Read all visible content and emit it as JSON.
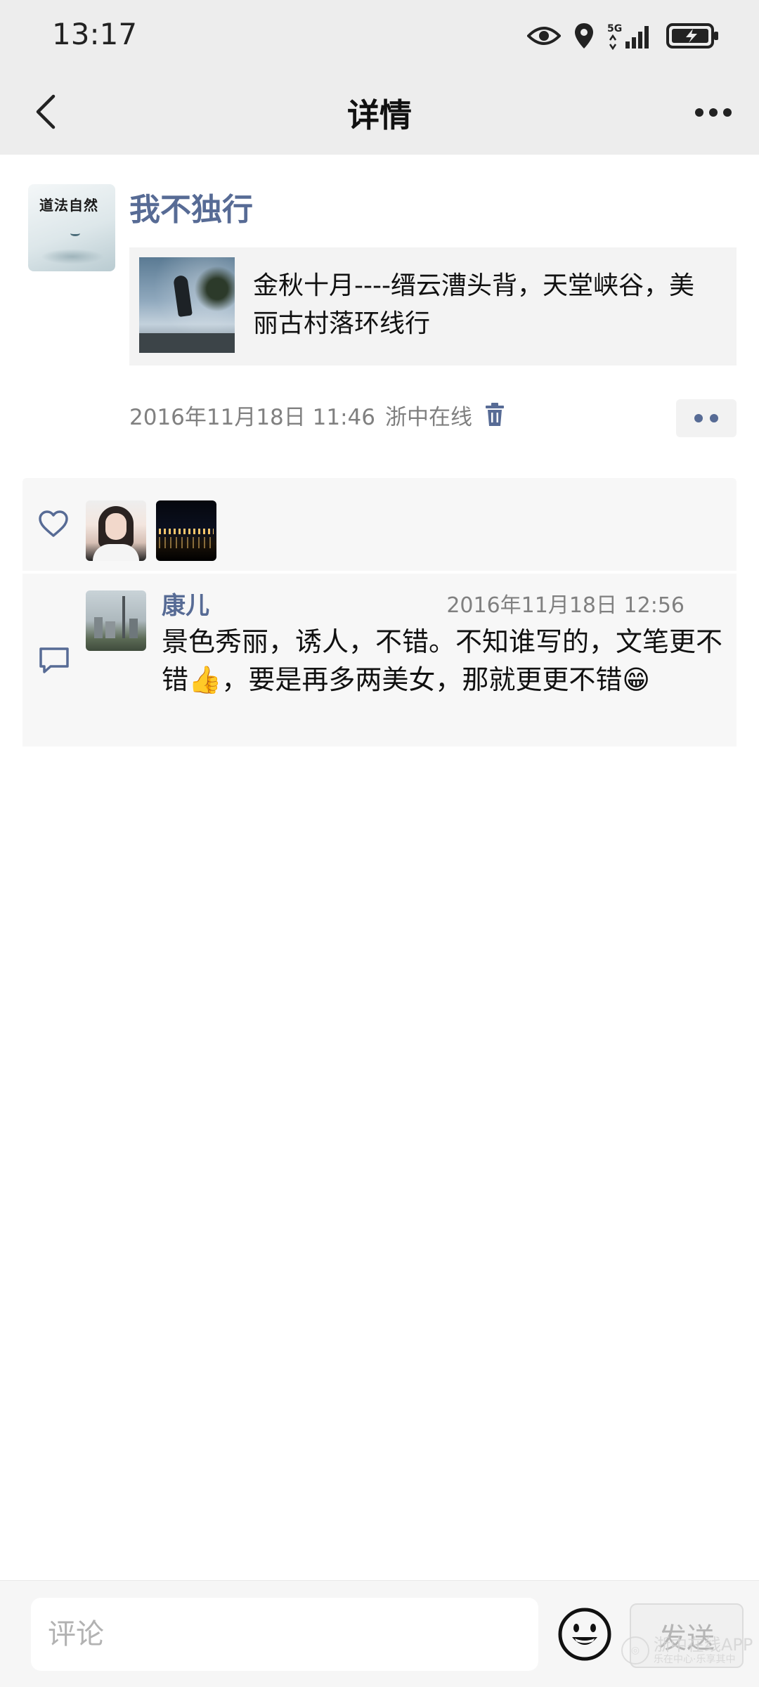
{
  "status": {
    "time": "13:17",
    "icons": [
      "eye-icon",
      "location-icon",
      "signal-5g-icon",
      "battery-charging-icon"
    ],
    "network_label": "5G"
  },
  "nav": {
    "title": "详情",
    "back_icon": "chevron-left-icon",
    "more_icon": "more-dots-icon"
  },
  "post": {
    "author": "我不独行",
    "avatar_calligraphy": "道法自然",
    "shared_title": "金秋十月----缙云漕头背，天堂峡谷，美丽古村落环线行",
    "timestamp": "2016年11月18日 11:46",
    "source": "浙中在线",
    "delete_icon": "trash-icon",
    "action_icon": "comment-like-dots-icon"
  },
  "likes": {
    "icon": "heart-icon",
    "avatars": [
      "woman-portrait-avatar",
      "night-city-avatar"
    ]
  },
  "comments": [
    {
      "author": "康儿",
      "time": "2016年11月18日 12:56",
      "text": "景色秀丽，诱人，不错。不知谁写的，文笔更不错👍，要是再多两美女，那就更更不错😁"
    }
  ],
  "bottom": {
    "placeholder": "评论",
    "emoji_icon": "smiley-icon",
    "send_label": "发送"
  },
  "watermark": {
    "text": "浙中在线APP",
    "sub": "乐在中心·乐享其中"
  },
  "colors": {
    "link_blue": "#576b95",
    "meta_gray": "#808080",
    "header_bg": "#ededed",
    "panel_bg": "#f7f7f7"
  }
}
